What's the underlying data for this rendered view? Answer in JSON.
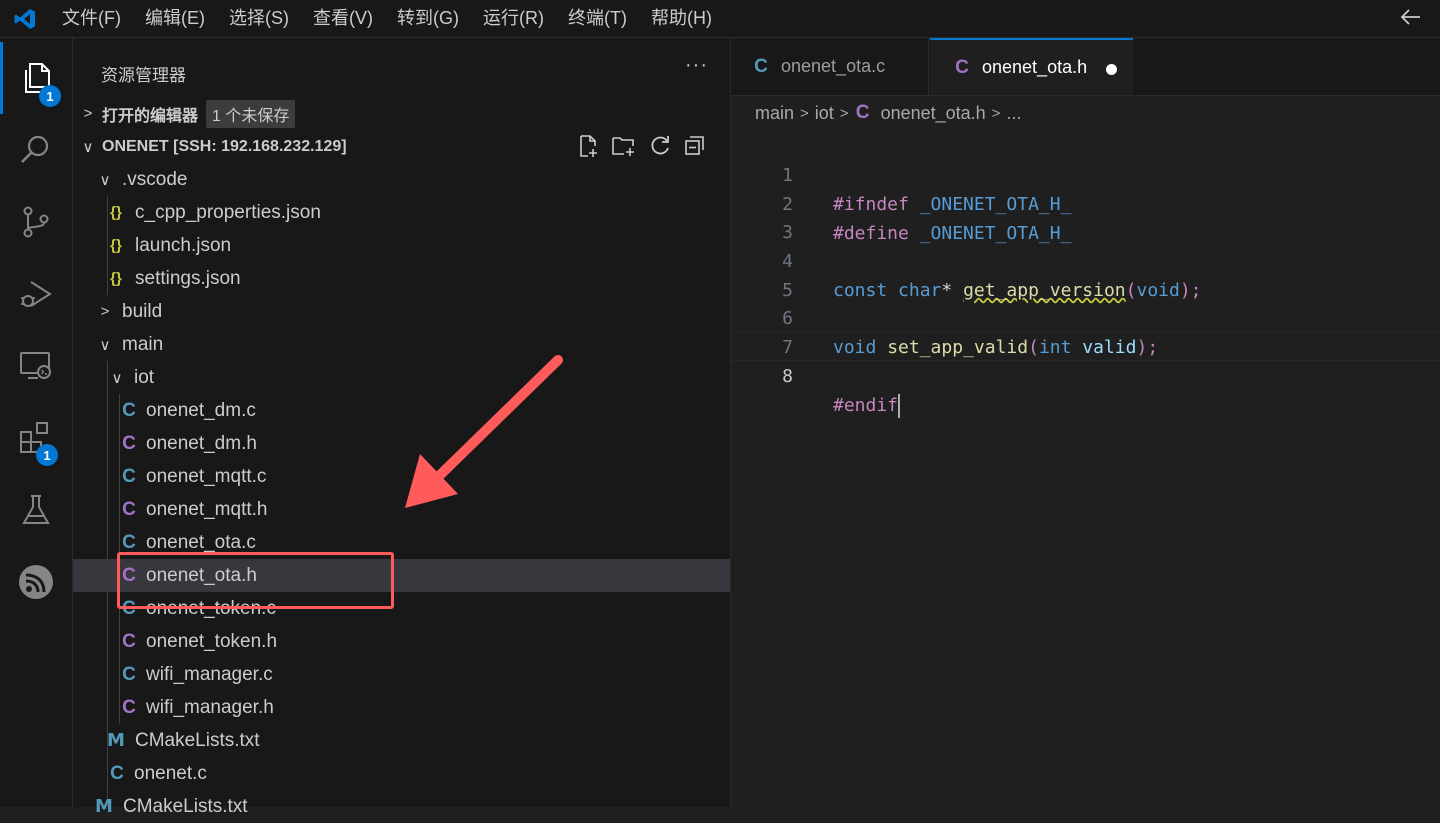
{
  "menu": [
    "文件(F)",
    "编辑(E)",
    "选择(S)",
    "查看(V)",
    "转到(G)",
    "运行(R)",
    "终端(T)",
    "帮助(H)"
  ],
  "activity": {
    "explorer_badge": "1",
    "extensions_badge": "1"
  },
  "sidebar": {
    "title": "资源管理器",
    "open_editors_label": "打开的编辑器",
    "unsaved_pill": "1 个未保存",
    "workspace_label": "ONENET [SSH: 192.168.232.129]"
  },
  "tree": [
    {
      "label": ".vscode",
      "type": "folder-open"
    },
    {
      "label": "c_cpp_properties.json",
      "type": "json"
    },
    {
      "label": "launch.json",
      "type": "json"
    },
    {
      "label": "settings.json",
      "type": "json"
    },
    {
      "label": "build",
      "type": "folder-closed"
    },
    {
      "label": "main",
      "type": "folder-open"
    },
    {
      "label": "iot",
      "type": "folder-open"
    },
    {
      "label": "onenet_dm.c",
      "type": "c"
    },
    {
      "label": "onenet_dm.h",
      "type": "h"
    },
    {
      "label": "onenet_mqtt.c",
      "type": "c"
    },
    {
      "label": "onenet_mqtt.h",
      "type": "h"
    },
    {
      "label": "onenet_ota.c",
      "type": "c"
    },
    {
      "label": "onenet_ota.h",
      "type": "h"
    },
    {
      "label": "onenet_token.c",
      "type": "c"
    },
    {
      "label": "onenet_token.h",
      "type": "h"
    },
    {
      "label": "wifi_manager.c",
      "type": "c"
    },
    {
      "label": "wifi_manager.h",
      "type": "h"
    },
    {
      "label": "CMakeLists.txt",
      "type": "cmake"
    },
    {
      "label": "onenet.c",
      "type": "c"
    },
    {
      "label": "CMakeLists.txt",
      "type": "cmake"
    }
  ],
  "tabs": [
    {
      "label": "onenet_ota.c",
      "icon": "C"
    },
    {
      "label": "onenet_ota.h",
      "icon": "C"
    }
  ],
  "breadcrumb": {
    "part1": "main",
    "part2": "iot",
    "file_icon": "C",
    "file": "onenet_ota.h",
    "more": "..."
  },
  "code": {
    "line_numbers": [
      "1",
      "2",
      "3",
      "4",
      "5",
      "6",
      "7",
      "8"
    ],
    "l1_directive": "#ifndef",
    "l1_macro": "_ONENET_OTA_H_",
    "l2_directive": "#define",
    "l2_macro": "_ONENET_OTA_H_",
    "l4_kw1": "const",
    "l4_kw2": "char",
    "l4_star": "*",
    "l4_fn": "get_app_version",
    "l4_open": "(",
    "l4_void": "void",
    "l4_close": ");",
    "l6_void": "void",
    "l6_fn": "set_app_valid",
    "l6_open": "(",
    "l6_int": "int",
    "l6_param": "valid",
    "l6_close": ");",
    "l8_directive": "#endif"
  },
  "icons": {
    "c_letter": "C",
    "json_glyph": "{}",
    "cmake_glyph": "M",
    "chevron_down": "∨",
    "chevron_right": ">"
  },
  "colors": {
    "accent": "#0078d4",
    "c_icon": "#519aba",
    "h_icon": "#a074c4",
    "json_icon": "#cbcb41",
    "annotation": "#ff5b5b"
  }
}
